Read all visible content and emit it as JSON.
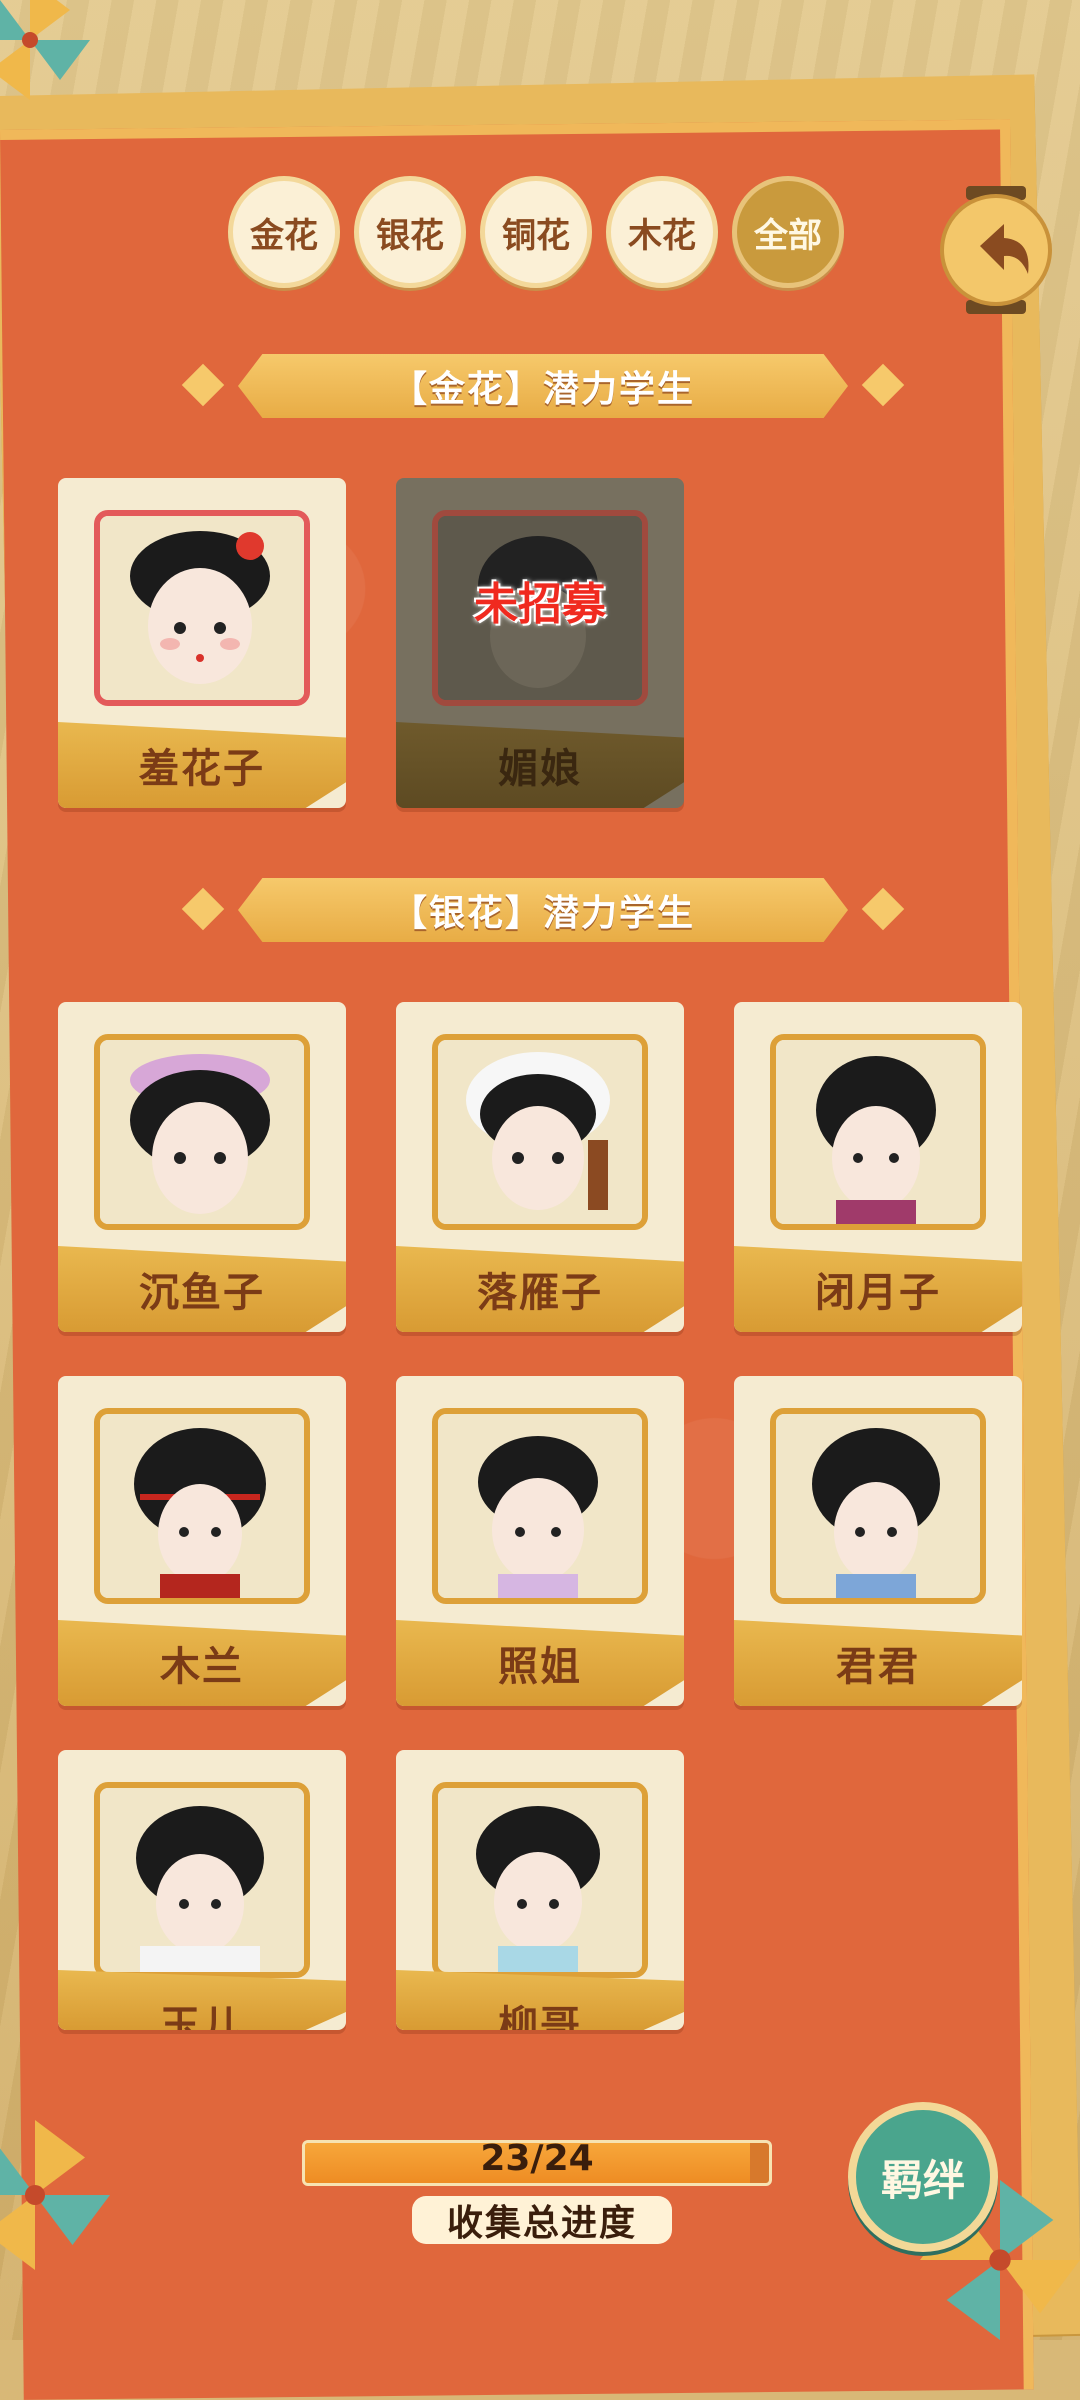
{
  "filters": [
    {
      "label": "金花",
      "active": false
    },
    {
      "label": "银花",
      "active": false
    },
    {
      "label": "铜花",
      "active": false
    },
    {
      "label": "木花",
      "active": false
    },
    {
      "label": "全部",
      "active": true
    }
  ],
  "sections": [
    {
      "title": "【金花】潜力学生"
    },
    {
      "title": "【银花】潜力学生"
    }
  ],
  "gold_students": [
    {
      "name": "羞花子",
      "recruited": true
    },
    {
      "name": "媚娘",
      "recruited": false,
      "status": "未招募"
    }
  ],
  "silver_students": [
    {
      "name": "沉鱼子"
    },
    {
      "name": "落雁子"
    },
    {
      "name": "闭月子"
    },
    {
      "name": "木兰"
    },
    {
      "name": "照姐"
    },
    {
      "name": "君君"
    },
    {
      "name": "玉儿"
    },
    {
      "name": "柳哥"
    }
  ],
  "progress": {
    "text": "23/24",
    "fraction": 0.958,
    "label": "收集总进度"
  },
  "bond_button": {
    "label": "羁绊"
  },
  "colors": {
    "board": "#e0673c",
    "gold": "#e9b84f",
    "teal": "#4aa58d"
  }
}
